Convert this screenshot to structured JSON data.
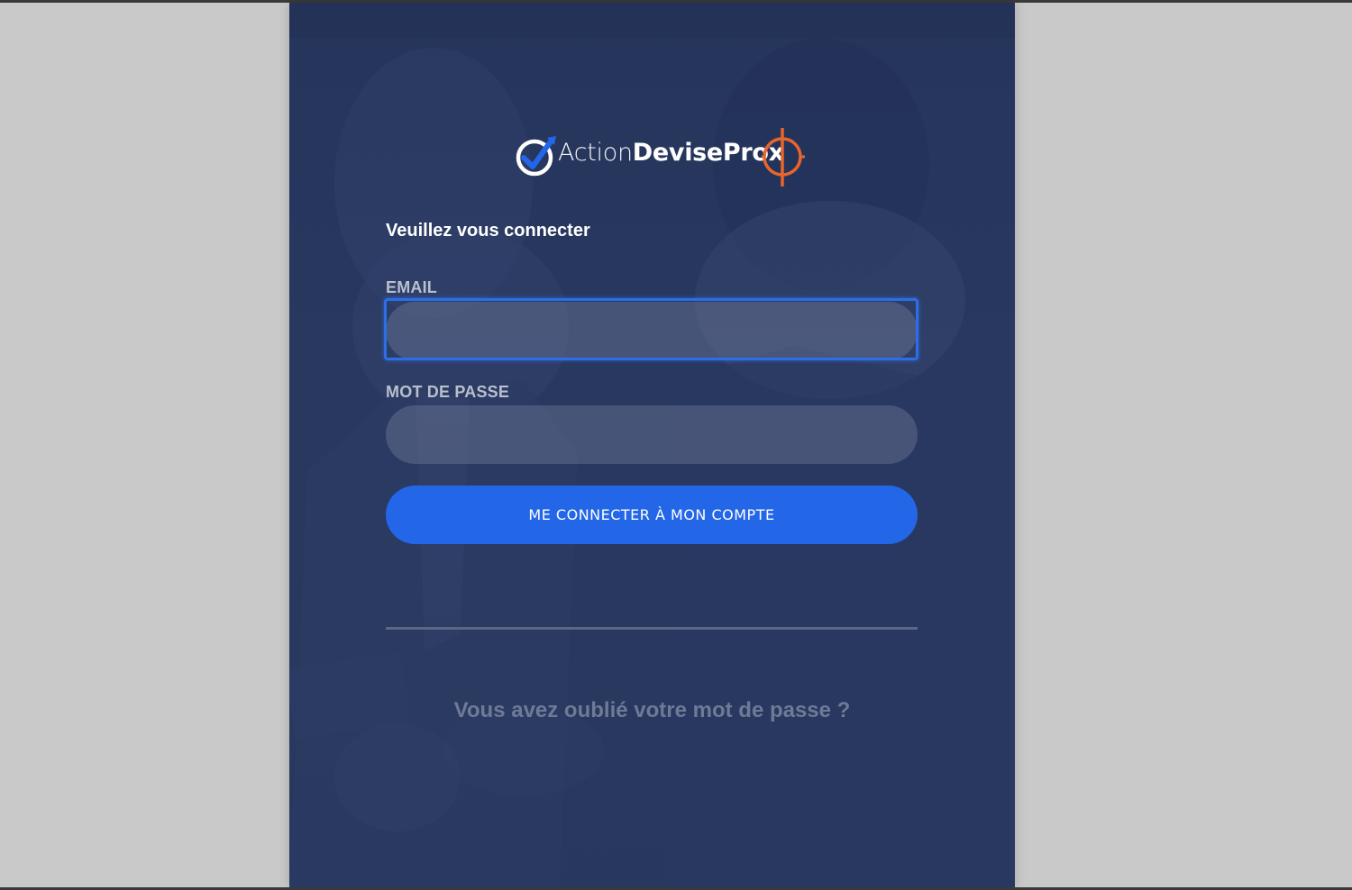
{
  "brand": {
    "name_light": "Action",
    "name_bold": "DeviseProx",
    "accent_orange": "#e8652b",
    "accent_blue": "#2366e8"
  },
  "login": {
    "heading": "Veuillez vous connecter",
    "email_label": "EMAIL",
    "email_value": "",
    "password_label": "MOT DE PASSE",
    "password_value": "",
    "submit_label": "ME CONNECTER À MON COMPTE",
    "forgot_link": "Vous avez oublié votre mot de passe ?"
  },
  "colors": {
    "page_background": "#c9c9c9",
    "panel_background": "#27365c",
    "button": "#2366e8",
    "focus_ring": "#2c6ee6"
  }
}
